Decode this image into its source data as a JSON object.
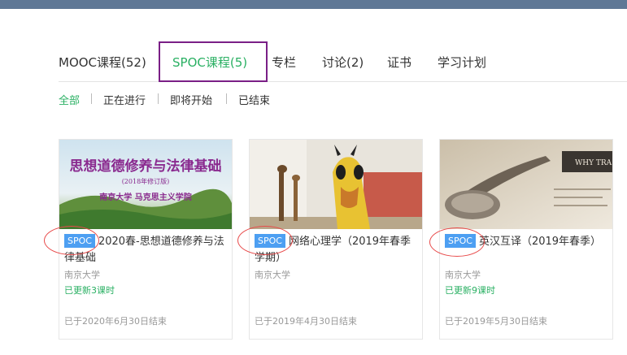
{
  "tabs": [
    {
      "label": "MOOC课程(52)",
      "active": false
    },
    {
      "label": "SPOC课程(5)",
      "active": true
    },
    {
      "label": "专栏",
      "active": false
    },
    {
      "label": "讨论(2)",
      "active": false
    },
    {
      "label": "证书",
      "active": false
    },
    {
      "label": "学习计划",
      "active": false
    }
  ],
  "filters": [
    {
      "label": "全部",
      "active": true
    },
    {
      "label": "正在进行",
      "active": false
    },
    {
      "label": "即将开始",
      "active": false
    },
    {
      "label": "已结束",
      "active": false
    }
  ],
  "courses": [
    {
      "badge": "SPOC",
      "title": "2020春-思想道德修养与法律基础",
      "school": "南京大学",
      "update": "已更新3课时",
      "end": "已于2020年6月30日结束",
      "image_text": {
        "line1": "思想道德修养与法律基础",
        "line2": "(2018年修订版)",
        "line3": "南京大学 马克思主义学院"
      }
    },
    {
      "badge": "SPOC",
      "title": "网络心理学（2019年春季学期）",
      "school": "南京大学",
      "update": "",
      "end": "已于2019年4月30日结束"
    },
    {
      "badge": "SPOC",
      "title": "英汉互译（2019年春季）",
      "school": "南京大学",
      "update": "已更新9课时",
      "end": "已于2019年5月30日结束",
      "image_text": {
        "line1": "WHY TRA"
      }
    }
  ],
  "colors": {
    "accent_green": "#2ab063",
    "spoc_badge": "#4d9ff2",
    "top_bar": "#5f7896",
    "highlight_box": "#7a1f86",
    "annotation_red": "#e84a4a"
  }
}
